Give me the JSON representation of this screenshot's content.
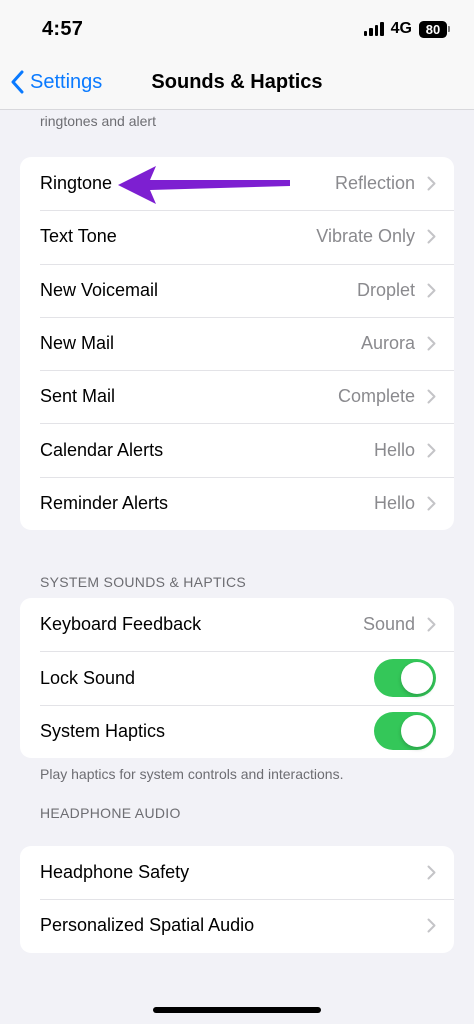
{
  "status_bar": {
    "time": "4:57",
    "network": "4G",
    "battery": "80",
    "signal_icon": "cellular-signal-icon"
  },
  "nav": {
    "back_label": "Settings",
    "title": "Sounds & Haptics"
  },
  "top_footer": "ringtones and alert",
  "sound_patterns": [
    {
      "label": "Ringtone",
      "value": "Reflection"
    },
    {
      "label": "Text Tone",
      "value": "Vibrate Only"
    },
    {
      "label": "New Voicemail",
      "value": "Droplet"
    },
    {
      "label": "New Mail",
      "value": "Aurora"
    },
    {
      "label": "Sent Mail",
      "value": "Complete"
    },
    {
      "label": "Calendar Alerts",
      "value": "Hello"
    },
    {
      "label": "Reminder Alerts",
      "value": "Hello"
    }
  ],
  "system_section": {
    "header": "SYSTEM SOUNDS & HAPTICS",
    "keyboard_feedback": {
      "label": "Keyboard Feedback",
      "value": "Sound"
    },
    "lock_sound": {
      "label": "Lock Sound",
      "on": true
    },
    "system_haptics": {
      "label": "System Haptics",
      "on": true
    },
    "footer": "Play haptics for system controls and interactions."
  },
  "headphone_section": {
    "header": "HEADPHONE AUDIO",
    "items": [
      {
        "label": "Headphone Safety"
      },
      {
        "label": "Personalized Spatial Audio"
      }
    ]
  },
  "colors": {
    "accent": "#0a7aff",
    "toggle_on": "#34c759",
    "annotation_arrow": "#7d1fd1"
  }
}
